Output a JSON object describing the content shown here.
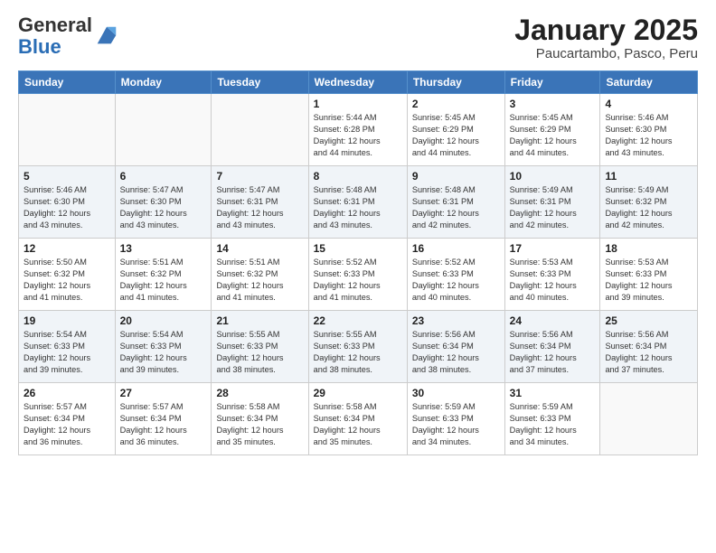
{
  "logo": {
    "general": "General",
    "blue": "Blue"
  },
  "header": {
    "title": "January 2025",
    "subtitle": "Paucartambo, Pasco, Peru"
  },
  "weekdays": [
    "Sunday",
    "Monday",
    "Tuesday",
    "Wednesday",
    "Thursday",
    "Friday",
    "Saturday"
  ],
  "weeks": [
    [
      {
        "day": "",
        "info": ""
      },
      {
        "day": "",
        "info": ""
      },
      {
        "day": "",
        "info": ""
      },
      {
        "day": "1",
        "info": "Sunrise: 5:44 AM\nSunset: 6:28 PM\nDaylight: 12 hours\nand 44 minutes."
      },
      {
        "day": "2",
        "info": "Sunrise: 5:45 AM\nSunset: 6:29 PM\nDaylight: 12 hours\nand 44 minutes."
      },
      {
        "day": "3",
        "info": "Sunrise: 5:45 AM\nSunset: 6:29 PM\nDaylight: 12 hours\nand 44 minutes."
      },
      {
        "day": "4",
        "info": "Sunrise: 5:46 AM\nSunset: 6:30 PM\nDaylight: 12 hours\nand 43 minutes."
      }
    ],
    [
      {
        "day": "5",
        "info": "Sunrise: 5:46 AM\nSunset: 6:30 PM\nDaylight: 12 hours\nand 43 minutes."
      },
      {
        "day": "6",
        "info": "Sunrise: 5:47 AM\nSunset: 6:30 PM\nDaylight: 12 hours\nand 43 minutes."
      },
      {
        "day": "7",
        "info": "Sunrise: 5:47 AM\nSunset: 6:31 PM\nDaylight: 12 hours\nand 43 minutes."
      },
      {
        "day": "8",
        "info": "Sunrise: 5:48 AM\nSunset: 6:31 PM\nDaylight: 12 hours\nand 43 minutes."
      },
      {
        "day": "9",
        "info": "Sunrise: 5:48 AM\nSunset: 6:31 PM\nDaylight: 12 hours\nand 42 minutes."
      },
      {
        "day": "10",
        "info": "Sunrise: 5:49 AM\nSunset: 6:31 PM\nDaylight: 12 hours\nand 42 minutes."
      },
      {
        "day": "11",
        "info": "Sunrise: 5:49 AM\nSunset: 6:32 PM\nDaylight: 12 hours\nand 42 minutes."
      }
    ],
    [
      {
        "day": "12",
        "info": "Sunrise: 5:50 AM\nSunset: 6:32 PM\nDaylight: 12 hours\nand 41 minutes."
      },
      {
        "day": "13",
        "info": "Sunrise: 5:51 AM\nSunset: 6:32 PM\nDaylight: 12 hours\nand 41 minutes."
      },
      {
        "day": "14",
        "info": "Sunrise: 5:51 AM\nSunset: 6:32 PM\nDaylight: 12 hours\nand 41 minutes."
      },
      {
        "day": "15",
        "info": "Sunrise: 5:52 AM\nSunset: 6:33 PM\nDaylight: 12 hours\nand 41 minutes."
      },
      {
        "day": "16",
        "info": "Sunrise: 5:52 AM\nSunset: 6:33 PM\nDaylight: 12 hours\nand 40 minutes."
      },
      {
        "day": "17",
        "info": "Sunrise: 5:53 AM\nSunset: 6:33 PM\nDaylight: 12 hours\nand 40 minutes."
      },
      {
        "day": "18",
        "info": "Sunrise: 5:53 AM\nSunset: 6:33 PM\nDaylight: 12 hours\nand 39 minutes."
      }
    ],
    [
      {
        "day": "19",
        "info": "Sunrise: 5:54 AM\nSunset: 6:33 PM\nDaylight: 12 hours\nand 39 minutes."
      },
      {
        "day": "20",
        "info": "Sunrise: 5:54 AM\nSunset: 6:33 PM\nDaylight: 12 hours\nand 39 minutes."
      },
      {
        "day": "21",
        "info": "Sunrise: 5:55 AM\nSunset: 6:33 PM\nDaylight: 12 hours\nand 38 minutes."
      },
      {
        "day": "22",
        "info": "Sunrise: 5:55 AM\nSunset: 6:33 PM\nDaylight: 12 hours\nand 38 minutes."
      },
      {
        "day": "23",
        "info": "Sunrise: 5:56 AM\nSunset: 6:34 PM\nDaylight: 12 hours\nand 38 minutes."
      },
      {
        "day": "24",
        "info": "Sunrise: 5:56 AM\nSunset: 6:34 PM\nDaylight: 12 hours\nand 37 minutes."
      },
      {
        "day": "25",
        "info": "Sunrise: 5:56 AM\nSunset: 6:34 PM\nDaylight: 12 hours\nand 37 minutes."
      }
    ],
    [
      {
        "day": "26",
        "info": "Sunrise: 5:57 AM\nSunset: 6:34 PM\nDaylight: 12 hours\nand 36 minutes."
      },
      {
        "day": "27",
        "info": "Sunrise: 5:57 AM\nSunset: 6:34 PM\nDaylight: 12 hours\nand 36 minutes."
      },
      {
        "day": "28",
        "info": "Sunrise: 5:58 AM\nSunset: 6:34 PM\nDaylight: 12 hours\nand 35 minutes."
      },
      {
        "day": "29",
        "info": "Sunrise: 5:58 AM\nSunset: 6:34 PM\nDaylight: 12 hours\nand 35 minutes."
      },
      {
        "day": "30",
        "info": "Sunrise: 5:59 AM\nSunset: 6:33 PM\nDaylight: 12 hours\nand 34 minutes."
      },
      {
        "day": "31",
        "info": "Sunrise: 5:59 AM\nSunset: 6:33 PM\nDaylight: 12 hours\nand 34 minutes."
      },
      {
        "day": "",
        "info": ""
      }
    ]
  ]
}
